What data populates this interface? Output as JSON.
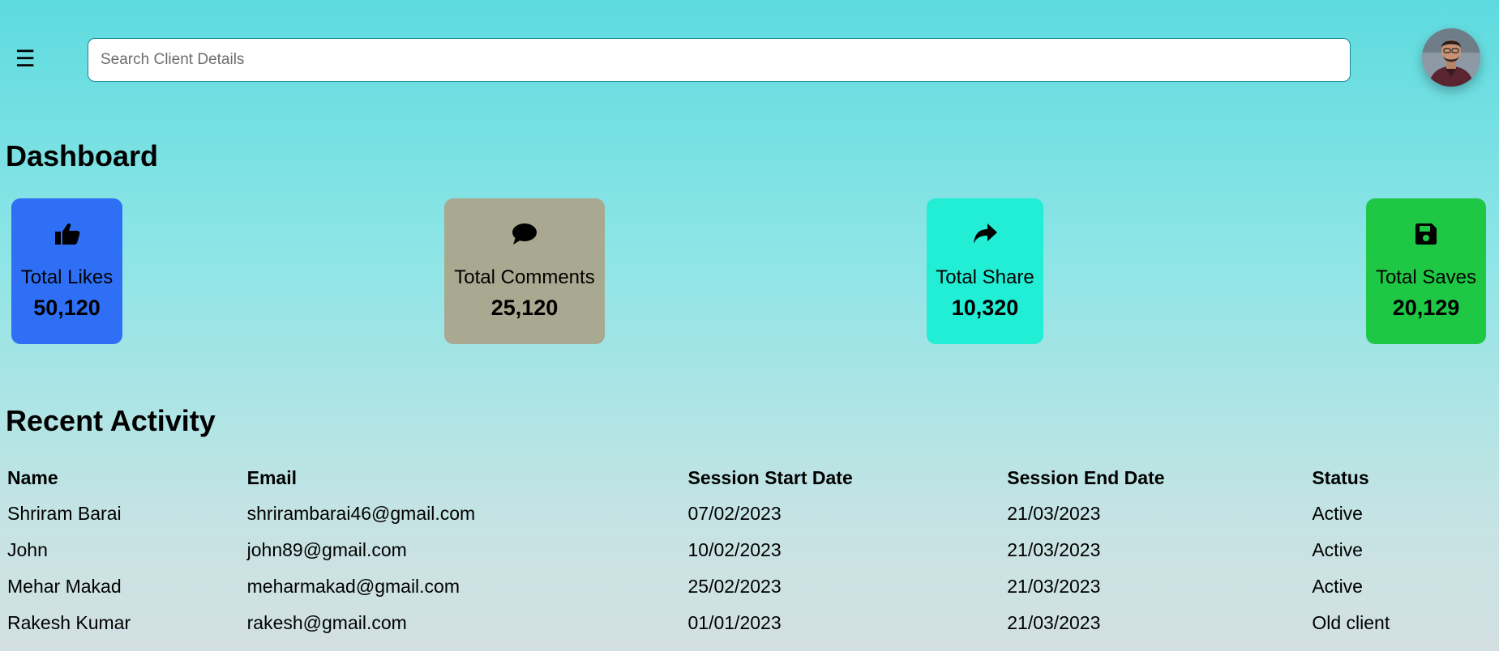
{
  "header": {
    "menu_icon": "hamburger-menu-icon",
    "menu_glyph": "☰",
    "search": {
      "placeholder": "Search Client Details",
      "value": ""
    },
    "avatar_icon": "user-avatar"
  },
  "dashboard": {
    "title": "Dashboard",
    "cards": [
      {
        "label": "Total Likes",
        "value": "50,120",
        "icon": "thumbs-up-icon",
        "color": "#2f6ff5"
      },
      {
        "label": "Total Comments",
        "value": "25,120",
        "icon": "comment-icon",
        "color": "#a8a990"
      },
      {
        "label": "Total Share",
        "value": "10,320",
        "icon": "share-icon",
        "color": "#22eed5"
      },
      {
        "label": "Total Saves",
        "value": "20,129",
        "icon": "save-icon",
        "color": "#1ec844"
      }
    ]
  },
  "recent_activity": {
    "title": "Recent Activity",
    "columns": [
      "Name",
      "Email",
      "Session Start Date",
      "Session End Date",
      "Status"
    ],
    "rows": [
      [
        "Shriram Barai",
        "shrirambarai46@gmail.com",
        "07/02/2023",
        "21/03/2023",
        "Active"
      ],
      [
        "John",
        "john89@gmail.com",
        "10/02/2023",
        "21/03/2023",
        "Active"
      ],
      [
        "Mehar Makad",
        "meharmakad@gmail.com",
        "25/02/2023",
        "21/03/2023",
        "Active"
      ],
      [
        "Rakesh Kumar",
        "rakesh@gmail.com",
        "01/01/2023",
        "21/03/2023",
        "Old client"
      ]
    ]
  },
  "colors": {
    "background_top": "#5ddbdf",
    "background_bottom": "#d3e0e2",
    "search_border": "#1c8a90"
  }
}
